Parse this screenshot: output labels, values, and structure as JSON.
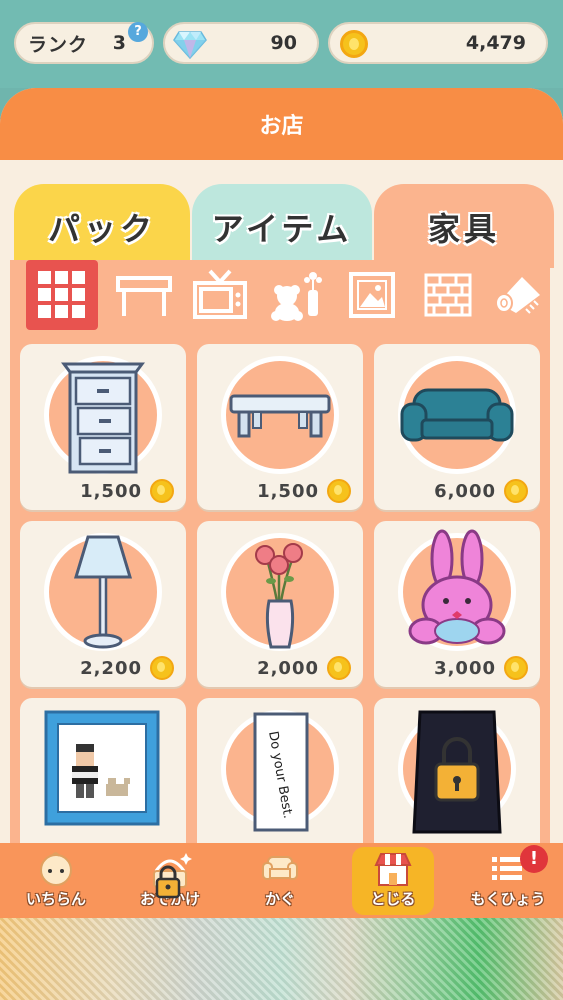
{
  "status": {
    "rank_label": "ランク",
    "rank_value": "3",
    "help": "?",
    "gems": "90",
    "coins": "4,479"
  },
  "shop": {
    "title": "お店",
    "tabs": [
      {
        "label": "パック"
      },
      {
        "label": "アイテム"
      },
      {
        "label": "家具"
      }
    ],
    "categories": [
      {
        "icon": "grid-all-icon",
        "active": true
      },
      {
        "icon": "table-icon"
      },
      {
        "icon": "tv-icon"
      },
      {
        "icon": "toys-icon"
      },
      {
        "icon": "picture-frame-icon"
      },
      {
        "icon": "brick-wall-icon"
      },
      {
        "icon": "rug-icon"
      }
    ],
    "items": [
      {
        "icon": "drawer-chest-icon",
        "price": "1,500"
      },
      {
        "icon": "low-table-icon",
        "price": "1,500"
      },
      {
        "icon": "sofa-icon",
        "price": "6,000"
      },
      {
        "icon": "floor-lamp-icon",
        "price": "2,200"
      },
      {
        "icon": "flower-vase-icon",
        "price": "2,000"
      },
      {
        "icon": "bunny-plush-icon",
        "price": "3,000"
      },
      {
        "icon": "pixel-portrait-icon",
        "price": ""
      },
      {
        "icon": "poster-icon",
        "poster_text": "Do your Best.",
        "price": ""
      },
      {
        "icon": "locked-cabinet-icon",
        "locked": true,
        "price": ""
      }
    ]
  },
  "nav": {
    "items": [
      {
        "label": "いちらん",
        "icon": "face-icon"
      },
      {
        "label": "おでかけ",
        "icon": "basket-icon",
        "locked": true
      },
      {
        "label": "かぐ",
        "icon": "sofa-icon"
      },
      {
        "label": "とじる",
        "icon": "shop-icon",
        "active": true
      },
      {
        "label": "もくひょう",
        "icon": "list-icon",
        "badge": "!"
      }
    ]
  },
  "colors": {
    "accent_orange": "#f88d45",
    "panel_bg": "#f9eee0",
    "furniture_tab": "#fbb48e",
    "pack_tab": "#fbd54a",
    "item_tab": "#bde7dd",
    "category_active": "#e8534f"
  }
}
